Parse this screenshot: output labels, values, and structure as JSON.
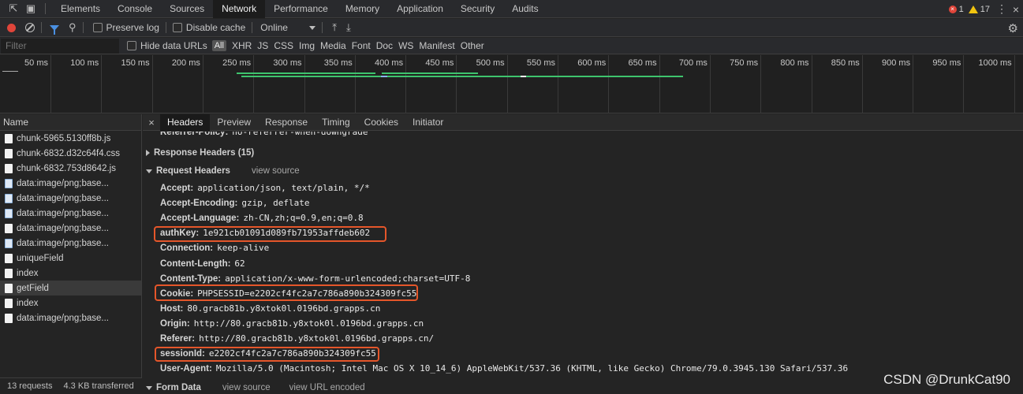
{
  "top_tabs": [
    "Elements",
    "Console",
    "Sources",
    "Network",
    "Performance",
    "Memory",
    "Application",
    "Security",
    "Audits"
  ],
  "active_tab": "Network",
  "error_count": "1",
  "warning_count": "17",
  "toolbar": {
    "preserve_log": "Preserve log",
    "disable_cache": "Disable cache",
    "throttle": "Online"
  },
  "filter": {
    "placeholder": "Filter",
    "hide_data_urls": "Hide data URLs",
    "types": [
      "All",
      "XHR",
      "JS",
      "CSS",
      "Img",
      "Media",
      "Font",
      "Doc",
      "WS",
      "Manifest",
      "Other"
    ]
  },
  "timeline": {
    "ticks": [
      "50 ms",
      "100 ms",
      "150 ms",
      "200 ms",
      "250 ms",
      "300 ms",
      "350 ms",
      "400 ms",
      "450 ms",
      "500 ms",
      "550 ms",
      "600 ms",
      "650 ms",
      "700 ms",
      "750 ms",
      "800 ms",
      "850 ms",
      "900 ms",
      "950 ms",
      "1000 ms"
    ]
  },
  "request_list": {
    "header": "Name",
    "items": [
      {
        "name": "chunk-5965.5130ff8b.js",
        "icon": "file-icon"
      },
      {
        "name": "chunk-6832.d32c64f4.css",
        "icon": "file-icon"
      },
      {
        "name": "chunk-6832.753d8642.js",
        "icon": "file-icon"
      },
      {
        "name": "data:image/png;base...",
        "icon": "image-icon"
      },
      {
        "name": "data:image/png;base...",
        "icon": "image-icon"
      },
      {
        "name": "data:image/png;base...",
        "icon": "image-icon"
      },
      {
        "name": "data:image/png;base...",
        "icon": "file-icon"
      },
      {
        "name": "data:image/png;base...",
        "icon": "image-icon"
      },
      {
        "name": "uniqueField",
        "icon": "file-icon"
      },
      {
        "name": "index",
        "icon": "file-icon"
      },
      {
        "name": "getField",
        "icon": "file-icon"
      },
      {
        "name": "index",
        "icon": "file-icon"
      },
      {
        "name": "data:image/png;base...",
        "icon": "file-icon"
      }
    ],
    "selected": "getField"
  },
  "status": {
    "requests": "13 requests",
    "transferred": "4.3 KB transferred"
  },
  "detail_tabs": [
    "Headers",
    "Preview",
    "Response",
    "Timing",
    "Cookies",
    "Initiator"
  ],
  "active_detail_tab": "Headers",
  "headers": {
    "partial_line": {
      "key": "Referrer-Policy:",
      "value": "no-referrer-when-downgrade"
    },
    "response_section": "Response Headers (15)",
    "request_section": "Request Headers",
    "view_source": "view source",
    "request_headers": [
      {
        "key": "Accept:",
        "value": "application/json, text/plain, */*"
      },
      {
        "key": "Accept-Encoding:",
        "value": "gzip, deflate"
      },
      {
        "key": "Accept-Language:",
        "value": "zh-CN,zh;q=0.9,en;q=0.8"
      },
      {
        "key": "authKey:",
        "value": "1e921cb01091d089fb71953affdeb602"
      },
      {
        "key": "Connection:",
        "value": "keep-alive"
      },
      {
        "key": "Content-Length:",
        "value": "62"
      },
      {
        "key": "Content-Type:",
        "value": "application/x-www-form-urlencoded;charset=UTF-8"
      },
      {
        "key": "Cookie:",
        "value": "PHPSESSID=e2202cf4fc2a7c786a890b324309fc55"
      },
      {
        "key": "Host:",
        "value": "80.gracb81b.y8xtok0l.0196bd.grapps.cn"
      },
      {
        "key": "Origin:",
        "value": "http://80.gracb81b.y8xtok0l.0196bd.grapps.cn"
      },
      {
        "key": "Referer:",
        "value": "http://80.gracb81b.y8xtok0l.0196bd.grapps.cn/"
      },
      {
        "key": "sessionId:",
        "value": "e2202cf4fc2a7c786a890b324309fc55"
      },
      {
        "key": "User-Agent:",
        "value": "Mozilla/5.0 (Macintosh; Intel Mac OS X 10_14_6) AppleWebKit/537.36 (KHTML, like Gecko) Chrome/79.0.3945.130 Safari/537.36"
      }
    ],
    "form_section": "Form Data",
    "form_view_source": "view source",
    "form_view_url_encoded": "view URL encoded"
  },
  "highlight_color": "#e5562a",
  "watermark": "CSDN @DrunkCat90"
}
